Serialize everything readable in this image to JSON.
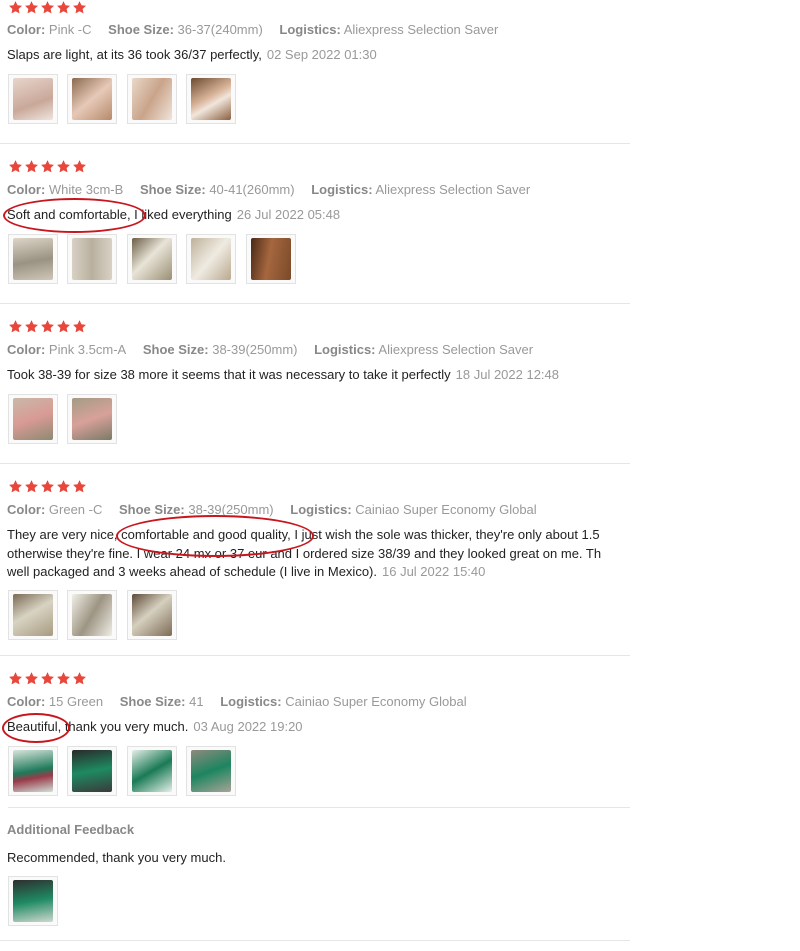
{
  "labels": {
    "color": "Color:",
    "shoe_size": "Shoe Size:",
    "logistics": "Logistics:"
  },
  "reviews": [
    {
      "rating": 5,
      "color": "Pink -C",
      "shoe_size": "36-37(240mm)",
      "logistics": "Aliexpress Selection Saver",
      "text": "Slaps are light, at its 36 took 36/37 perfectly,",
      "date": "02 Sep 2022 01:30",
      "photos": [
        "photo-pink-slipper-1",
        "photo-pink-slipper-2",
        "photo-pink-slipper-3",
        "photo-pink-slipper-4"
      ]
    },
    {
      "rating": 5,
      "color": "White 3cm-B",
      "shoe_size": "40-41(260mm)",
      "logistics": "Aliexpress Selection Saver",
      "text": "Soft and comfortable, I liked everything",
      "date": "26 Jul 2022 05:48",
      "photos": [
        "photo-white-slipper-1",
        "photo-white-slipper-2",
        "photo-white-slipper-3",
        "photo-white-slipper-4",
        "photo-white-slipper-5"
      ]
    },
    {
      "rating": 5,
      "color": "Pink 3.5cm-A",
      "shoe_size": "38-39(250mm)",
      "logistics": "Aliexpress Selection Saver",
      "text": "Took 38-39 for size 38 more it seems that it was necessary to take it perfectly",
      "date": "18 Jul 2022 12:48",
      "photos": [
        "photo-pink-slipper-worn-1",
        "photo-pink-slipper-worn-2"
      ]
    },
    {
      "rating": 5,
      "color": "Green -C",
      "shoe_size": "38-39(250mm)",
      "logistics": "Cainiao Super Economy Global",
      "text_lines": [
        "They are very nice, comfortable and good quality, I just wish the sole was thicker, they're only about 1.5",
        "otherwise they're fine. I wear 24 mx or 37 eur and I ordered size 38/39 and they looked great on me. Th",
        "well packaged and 3 weeks ahead of schedule (I live in Mexico)."
      ],
      "date": "16 Jul 2022 15:40",
      "photos": [
        "photo-green-slipper-1",
        "photo-green-slipper-2",
        "photo-green-slipper-3"
      ]
    },
    {
      "rating": 5,
      "color": "15 Green",
      "shoe_size": "41",
      "logistics": "Cainiao Super Economy Global",
      "text": "Beautiful, thank you very much.",
      "date": "03 Aug 2022 19:20",
      "photos": [
        "photo-green-slipper-a",
        "photo-green-slipper-b",
        "photo-green-slipper-c",
        "photo-green-slipper-d"
      ],
      "additional_feedback": {
        "title": "Additional Feedback",
        "text": "Recommended, thank you very much.",
        "photos": [
          "photo-green-slipper-extra"
        ]
      }
    }
  ],
  "colors": {
    "star": "#e8483c",
    "highlight_circle": "#c8161d",
    "muted_text": "#999999",
    "label_text": "#888888",
    "body_text": "#222222",
    "divider": "#e6e6e6"
  }
}
